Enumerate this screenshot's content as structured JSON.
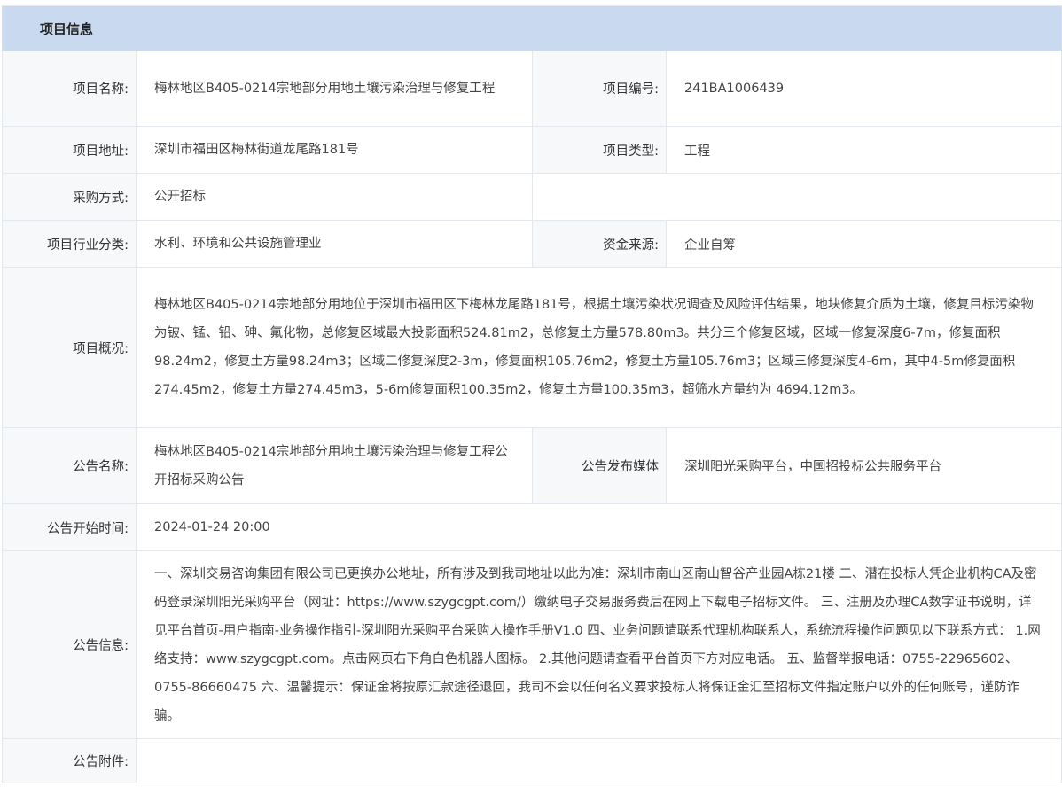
{
  "header": {
    "title": "项目信息"
  },
  "rows": {
    "project_name": {
      "label": "项目名称:",
      "value": "梅林地区B405-0214宗地部分用地土壤污染治理与修复工程"
    },
    "project_code": {
      "label": "项目编号:",
      "value": "241BA1006439"
    },
    "project_address": {
      "label": "项目地址:",
      "value": "深圳市福田区梅林街道龙尾路181号"
    },
    "project_type": {
      "label": "项目类型:",
      "value": "工程"
    },
    "procurement_method": {
      "label": "采购方式:",
      "value": "公开招标"
    },
    "industry": {
      "label": "项目行业分类:",
      "value": "水利、环境和公共设施管理业"
    },
    "funding_source": {
      "label": "资金来源:",
      "value": "企业自筹"
    },
    "overview": {
      "label": "项目概况:",
      "value": "梅林地区B405-0214宗地部分用地位于深圳市福田区下梅林龙尾路181号，根据土壤污染状况调查及风险评估结果，地块修复介质为土壤，修复目标污染物为铍、锰、铅、砷、氟化物，总修复区域最大投影面积524.81m2，总修复土方量578.80m3。共分三个修复区域，区域一修复深度6-7m，修复面积98.24m2，修复土方量98.24m3；区域二修复深度2-3m，修复面积105.76m2，修复土方量105.76m3；区域三修复深度4-6m，其中4-5m修复面积274.45m2，修复土方量274.45m3，5-6m修复面积100.35m2，修复土方量100.35m3，超筛水方量约为 4694.12m3。"
    },
    "notice_name": {
      "label": "公告名称:",
      "value": "梅林地区B405-0214宗地部分用地土壤污染治理与修复工程公开招标采购公告"
    },
    "notice_media": {
      "label": "公告发布媒体",
      "value": "深圳阳光采购平台，中国招投标公共服务平台"
    },
    "notice_start": {
      "label": "公告开始时间:",
      "value": "2024-01-24 20:00"
    },
    "notice_info": {
      "label": "公告信息:",
      "value": "一、深圳交易咨询集团有限公司已更换办公地址，所有涉及到我司地址以此为准：深圳市南山区南山智谷产业园A栋21楼 二、潜在投标人凭企业机构CA及密码登录深圳阳光采购平台（网址：https://www.szygcgpt.com/）缴纳电子交易服务费后在网上下载电子招标文件。 三、注册及办理CA数字证书说明，详见平台首页-用户指南-业务操作指引-深圳阳光采购平台采购人操作手册V1.0 四、业务问题请联系代理机构联系人，系统流程操作问题见以下联系方式： 1.网络支持：www.szygcgpt.com。点击网页右下角白色机器人图标。 2.其他问题请查看平台首页下方对应电话。 五、监督举报电话：0755-22965602、0755-86660475 六、温馨提示：保证金将按原汇款途径退回，我司不会以任何名义要求投标人将保证金汇至招标文件指定账户以外的任何账号，谨防诈骗。"
    },
    "notice_attachment": {
      "label": "公告附件:",
      "value": ""
    }
  }
}
